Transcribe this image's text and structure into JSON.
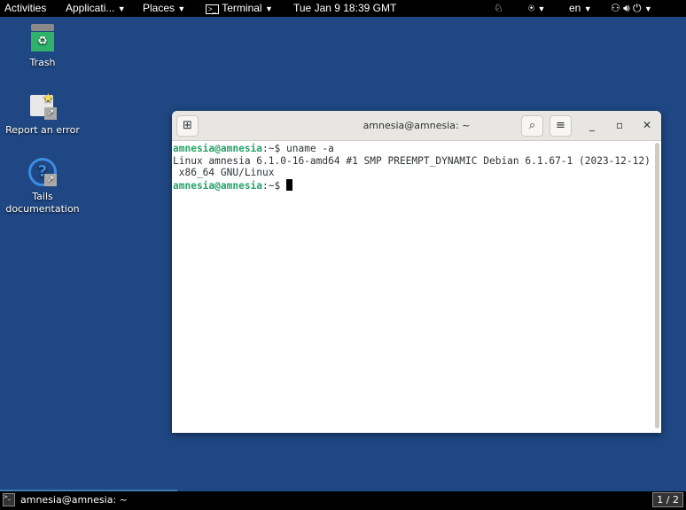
{
  "topbar": {
    "activities": "Activities",
    "applications": "Applicati...",
    "places": "Places",
    "terminal": "Terminal",
    "clock": "Tue Jan 9  18:39 GMT",
    "language": "en"
  },
  "desktop": {
    "icons": [
      {
        "label": "Trash"
      },
      {
        "label": "Report an error"
      },
      {
        "label": "Tails documentation"
      }
    ]
  },
  "terminal": {
    "title": "amnesia@amnesia: ~",
    "lines": [
      {
        "prompt": "amnesia@amnesia",
        "path": ":~$ ",
        "text": "uname -a"
      },
      {
        "text": "Linux amnesia 6.1.0-16-amd64 #1 SMP PREEMPT_DYNAMIC Debian 6.1.67-1 (2023-12-12)"
      },
      {
        "text": " x86_64 GNU/Linux"
      },
      {
        "prompt": "amnesia@amnesia",
        "path": ":~$ ",
        "text": ""
      }
    ]
  },
  "taskbar": {
    "window": "amnesia@amnesia: ~",
    "workspace": "1 / 2"
  },
  "colors": {
    "desktop": "#1f4783",
    "prompt": "#26a269"
  }
}
